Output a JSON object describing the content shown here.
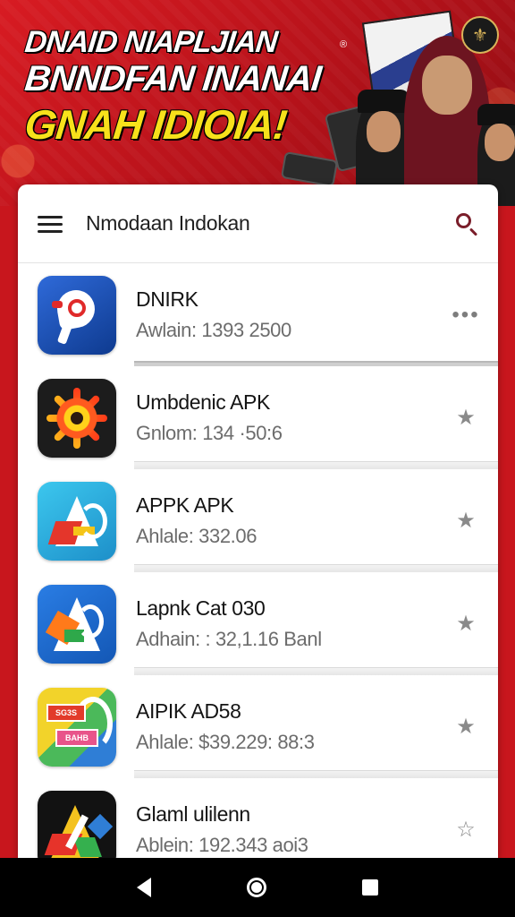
{
  "banner": {
    "line1": "DNAID NIAPLJIAN",
    "line2": "BNNDFAN INANAI",
    "line3": "GNAH IDIOIA!",
    "registered_mark": "®"
  },
  "appbar": {
    "title": "Nmodaan Indokan",
    "menu_icon": "hamburger-icon",
    "search_icon": "search-icon"
  },
  "apps": [
    {
      "name": "DNIRK",
      "meta": "Awlain: 1393 2500",
      "action": "more",
      "action_glyph": "•••"
    },
    {
      "name": "Umbdenic APK",
      "meta": "Gnlom: 134 ·50:6",
      "action": "star",
      "action_glyph": "★"
    },
    {
      "name": "APPK APK",
      "meta": "Ahlale: 332.06",
      "action": "star",
      "action_glyph": "★"
    },
    {
      "name": "Lapnk Cat 030",
      "meta": "Adhain: : 32,1.16 Banl",
      "action": "star",
      "action_glyph": "★"
    },
    {
      "name": "AIPIK  AD58",
      "meta": "Ahlale: $39.229: 88:3",
      "action": "star",
      "action_glyph": "★"
    },
    {
      "name": "Glaml ulilenn",
      "meta": "Ablein: 192.343 aoi3",
      "action": "star-outline",
      "action_glyph": "☆"
    }
  ],
  "icon_tags": {
    "tag1": "SG3S",
    "tag2": "BAHB"
  },
  "colors": {
    "brand_red": "#c8161d",
    "banner_yellow": "#f7e11b",
    "search_icon": "#7a1e2a"
  },
  "navbar": {
    "back": "back-icon",
    "home": "home-icon",
    "recent": "recent-apps-icon"
  }
}
